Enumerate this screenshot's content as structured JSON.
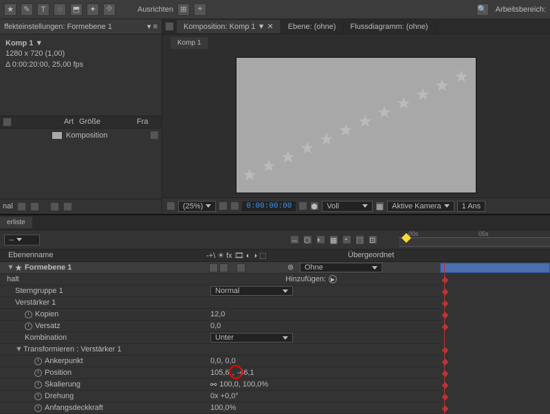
{
  "toolbar": {
    "align_label": "Ausrichten",
    "snap_on": true
  },
  "workspace": {
    "label": "Arbeitsbereich:"
  },
  "project_panel": {
    "tab": "ffekteinstellungen: Formebene 1",
    "comp_name": "Komp 1",
    "resolution": "1280 x 720 (1,00)",
    "duration": "Δ 0:00:20:00, 25,00 fps",
    "col_type": "Art",
    "col_size": "Größe",
    "col_fr": "Fra",
    "item_name": "Komposition",
    "footer_label": "nal"
  },
  "viewer": {
    "tabs": {
      "comp": "Komposition: Komp 1",
      "layer": "Ebene: (ohne)",
      "flow": "Flussdiagramm: (ohne)"
    },
    "subtab": "Komp 1",
    "footer": {
      "zoom": "(25%)",
      "timecode": "0:00:00:00",
      "resolution": "Voll",
      "camera": "Aktive Kamera",
      "views": "1 Ans"
    }
  },
  "timeline": {
    "tab": "erliste",
    "ruler": {
      "t0": "00s",
      "t1": "05s"
    },
    "col_name": "Ebenenname",
    "col_parent": "Übergeordnet",
    "add_label": "Hinzufügen:",
    "layer": {
      "name": "Formebene 1",
      "parent_none": "Ohne"
    },
    "rows": {
      "halt": "halt",
      "sterngruppe": "Sterngruppe 1",
      "sterngruppe_mode": "Normal",
      "verstaerker": "Verstärker 1",
      "kopien": "Kopien",
      "kopien_val": "12,0",
      "versatz": "Versatz",
      "versatz_val": "0,0",
      "kombination": "Kombination",
      "kombination_val": "Unter",
      "transform": "Transformieren : Verstärker 1",
      "ankerpunkt": "Ankerpunkt",
      "ankerpunkt_val": "0,0, 0,0",
      "position": "Position",
      "position_x": "105,6",
      "position_y": "-46,1",
      "skalierung": "Skalierung",
      "skalierung_val": "100,0, 100,0%",
      "drehung": "Drehung",
      "drehung_val": "0x +0,0°",
      "deckkraft": "Anfangsdeckkraft",
      "deckkraft_val": "100,0%"
    }
  }
}
